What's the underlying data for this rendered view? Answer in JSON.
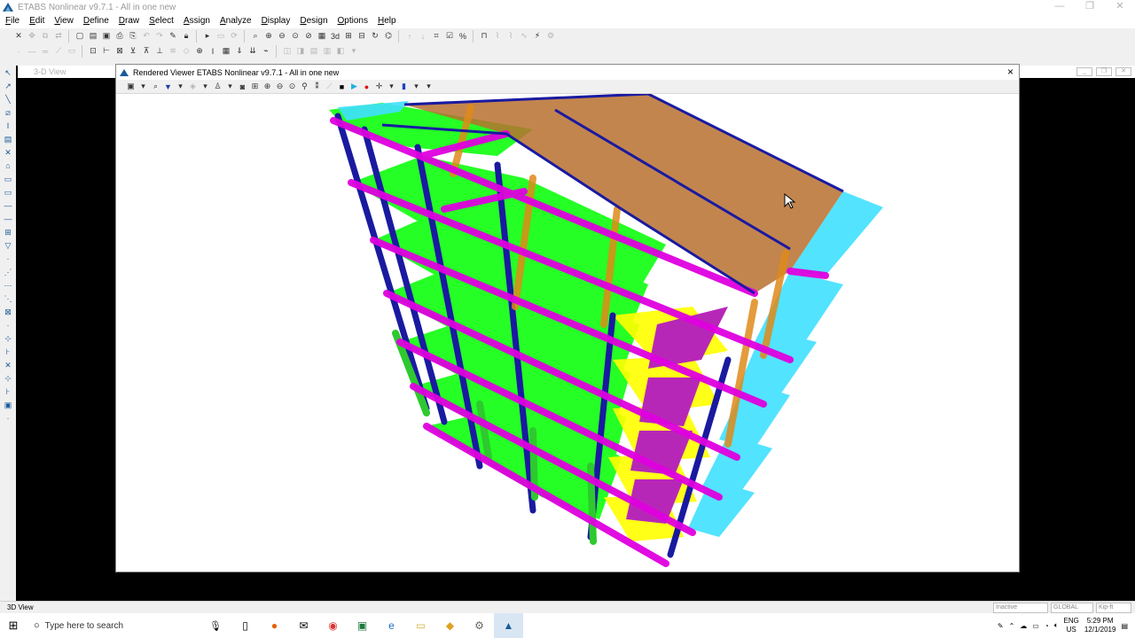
{
  "window": {
    "title": "ETABS Nonlinear v9.7.1 - All in one new"
  },
  "menu": [
    "File",
    "Edit",
    "View",
    "Define",
    "Draw",
    "Select",
    "Assign",
    "Analyze",
    "Display",
    "Design",
    "Options",
    "Help"
  ],
  "toolbar": {
    "view3d_label": "3d"
  },
  "background_window": {
    "title": "3-D View"
  },
  "viewer": {
    "title": "Rendered Viewer ETABS Nonlinear v9.7.1 - All in one new",
    "close_label": "×"
  },
  "status": {
    "view_label": "3D View",
    "status_select": "Inactive",
    "coord_select": "GLOBAL",
    "units_select": "Kip-ft"
  },
  "taskbar": {
    "search_placeholder": "Type here to search",
    "lang": "ENG",
    "region": "US",
    "time": "5:29 PM",
    "date": "12/1/2019"
  },
  "colors": {
    "beams": "#e000e0",
    "columns": "#1a1aa0",
    "slabs": "#00ff00",
    "roof": "#b8702f",
    "balcony": "#40e0ff",
    "stairs": "#ffff00"
  }
}
